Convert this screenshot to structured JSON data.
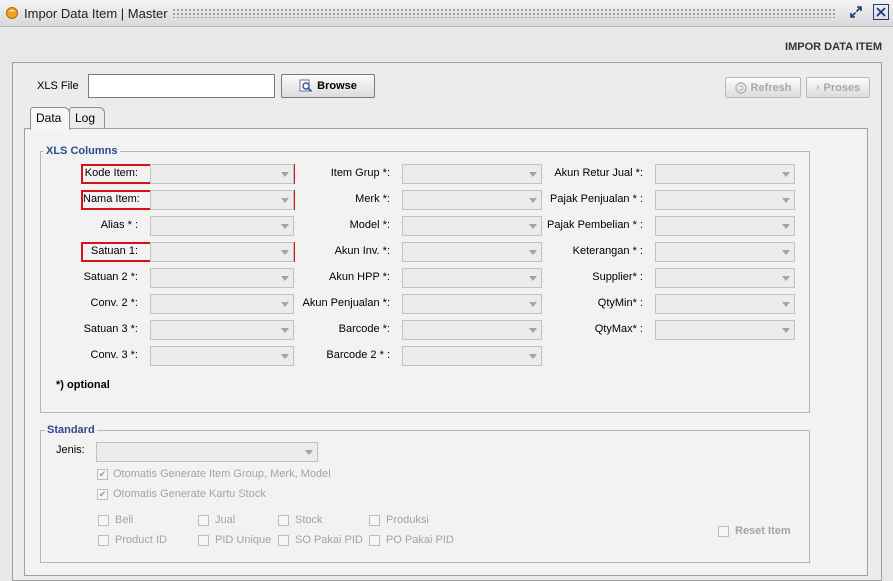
{
  "window": {
    "title": "Impor Data Item | Master"
  },
  "header": {
    "title": "IMPOR DATA ITEM"
  },
  "file": {
    "label": "XLS File",
    "value": "",
    "browse_label": "Browse",
    "refresh_label": "Refresh",
    "proses_label": "Proses"
  },
  "tabs": {
    "data": "Data",
    "log": "Log"
  },
  "xls_columns": {
    "legend": "XLS Columns",
    "col1": [
      "Kode Item:",
      "Nama Item:",
      "Alias * :",
      "Satuan 1:",
      "Satuan 2 *:",
      "Conv. 2 *:",
      "Satuan 3 *:",
      "Conv. 3 *:"
    ],
    "col2": [
      "Item Grup *:",
      "Merk *:",
      "Model *:",
      "Akun Inv. *:",
      "Akun HPP *:",
      "Akun Penjualan *:",
      "Barcode *:",
      "Barcode 2 * :"
    ],
    "col3": [
      "Akun Retur Jual *:",
      "Pajak Penjualan * :",
      "Pajak Pembelian * :",
      "Keterangan * :",
      "Supplier* :",
      "QtyMin* :",
      "QtyMax* :"
    ],
    "optional_note": "*) optional"
  },
  "standard": {
    "legend": "Standard",
    "jenis_label": "Jenis:",
    "jenis_value": "",
    "auto_group_label": "Otomatis Generate Item Group, Merk, Model",
    "auto_kartu_label": "Otomatis Generate Kartu Stock",
    "flags_row1": [
      "Beli",
      "Jual",
      "Stock",
      "Produksi"
    ],
    "flags_row2": [
      "Product ID",
      "PID Unique",
      "SO Pakai PID",
      "PO Pakai PID"
    ],
    "reset_label": "Reset Item"
  },
  "colors": {
    "required_highlight": "#d4141d",
    "legend_text": "#2b4b8a",
    "window_button": "#1c3c80"
  }
}
